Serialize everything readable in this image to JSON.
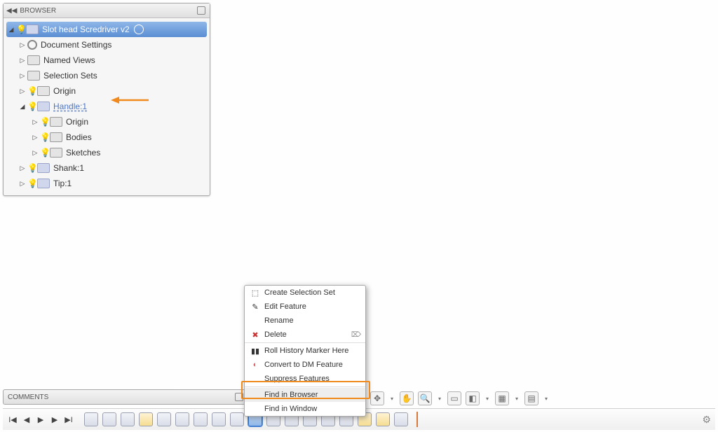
{
  "browser": {
    "title": "BROWSER",
    "root": "Slot head Scredriver v2",
    "items": {
      "doc_settings": "Document Settings",
      "named_views": "Named Views",
      "selection_sets": "Selection Sets",
      "origin": "Origin",
      "handle": "Handle:1",
      "handle_origin": "Origin",
      "handle_bodies": "Bodies",
      "handle_sketches": "Sketches",
      "shank": "Shank:1",
      "tip": "Tip:1"
    }
  },
  "context_menu": {
    "items": [
      "Create Selection Set",
      "Edit Feature",
      "Rename",
      "Delete",
      "Roll History Marker Here",
      "Convert to DM Feature",
      "Suppress Features",
      "Find in Browser",
      "Find in Window"
    ],
    "delete_shortcut": "⌦"
  },
  "comments": {
    "title": "COMMENTS"
  }
}
